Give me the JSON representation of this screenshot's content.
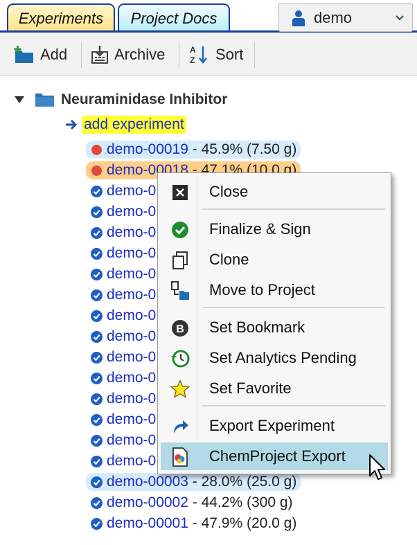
{
  "tabs": [
    {
      "label": "Experiments"
    },
    {
      "label": "Project Docs"
    }
  ],
  "user": {
    "name": "demo"
  },
  "toolbar": {
    "add_label": "Add",
    "archive_label": "Archive",
    "sort_label": "Sort"
  },
  "project": {
    "title": "Neuraminidase Inhibitor",
    "add_experiment_label": "add experiment"
  },
  "experiments": [
    {
      "id": "demo-00019",
      "rest": " - 45.9% (7.50 g)",
      "status": "open"
    },
    {
      "id": "demo-00018",
      "rest": " - 47.1% (10.0 g)",
      "status": "open"
    },
    {
      "id": "demo-0",
      "rest": "",
      "status": "signed"
    },
    {
      "id": "demo-0",
      "rest": "",
      "status": "signed"
    },
    {
      "id": "demo-0",
      "rest": "",
      "status": "signed"
    },
    {
      "id": "demo-0",
      "rest": "",
      "status": "signed"
    },
    {
      "id": "demo-0",
      "rest": "",
      "status": "signed"
    },
    {
      "id": "demo-0",
      "rest": "",
      "status": "signed"
    },
    {
      "id": "demo-0",
      "rest": "",
      "status": "signed"
    },
    {
      "id": "demo-0",
      "rest": "",
      "status": "signed"
    },
    {
      "id": "demo-0",
      "rest": "",
      "status": "signed"
    },
    {
      "id": "demo-0",
      "rest": "",
      "status": "signed"
    },
    {
      "id": "demo-0",
      "rest": "",
      "status": "signed"
    },
    {
      "id": "demo-0",
      "rest": "",
      "status": "signed"
    },
    {
      "id": "demo-0",
      "rest": "",
      "status": "signed"
    },
    {
      "id": "demo-0",
      "rest": "",
      "status": "signed"
    },
    {
      "id": "demo-00003",
      "rest": " - 28.0% (25.0 g)",
      "status": "signed"
    },
    {
      "id": "demo-00002",
      "rest": " - 44.2% (300 g)",
      "status": "signed"
    },
    {
      "id": "demo-00001",
      "rest": " - 47.9% (20.0 g)",
      "status": "signed"
    }
  ],
  "context_menu": {
    "close": "Close",
    "finalize": "Finalize & Sign",
    "clone": "Clone",
    "move": "Move to Project",
    "bookmark": "Set Bookmark",
    "analytics": "Set Analytics Pending",
    "favorite": "Set Favorite",
    "export": "Export Experiment",
    "chemproject": "ChemProject Export"
  },
  "colors": {
    "tab_border": "#1a3c9c",
    "link_blue": "#1a2fc0",
    "highlight_yellow": "#ffff33",
    "selection_blue": "#d6ebfb",
    "selection_orange": "#ffcf8a",
    "menu_active": "#b2d9e6"
  }
}
